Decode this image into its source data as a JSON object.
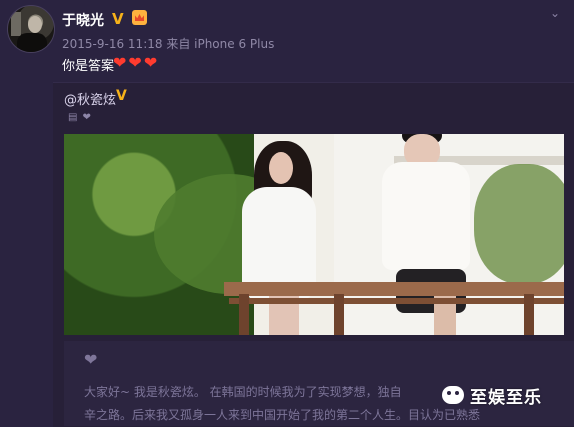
{
  "post": {
    "author": "于晓光",
    "v_badge": "V",
    "meta": "2015-9-16 11:18 来自 iPhone 6 Plus",
    "message": "你是答案",
    "hearts": [
      "❤",
      "❤",
      "❤"
    ]
  },
  "repost": {
    "author": "@秋瓷炫",
    "v_badge": "V",
    "icons": [
      "▤",
      "❤"
    ]
  },
  "caption": {
    "line1": "大家好~ 我是秋瓷炫。 在韩国的时候我为了实现梦想，独自",
    "line2": "辛之路。后来我又孤身一人来到中国开始了我的第二个人生。目认为已熟悉"
  },
  "watermark": {
    "text": "至娱至乐"
  },
  "colors": {
    "background": "#2a2340",
    "accent": "#f6b21a",
    "heart": "#ff3b2f"
  }
}
